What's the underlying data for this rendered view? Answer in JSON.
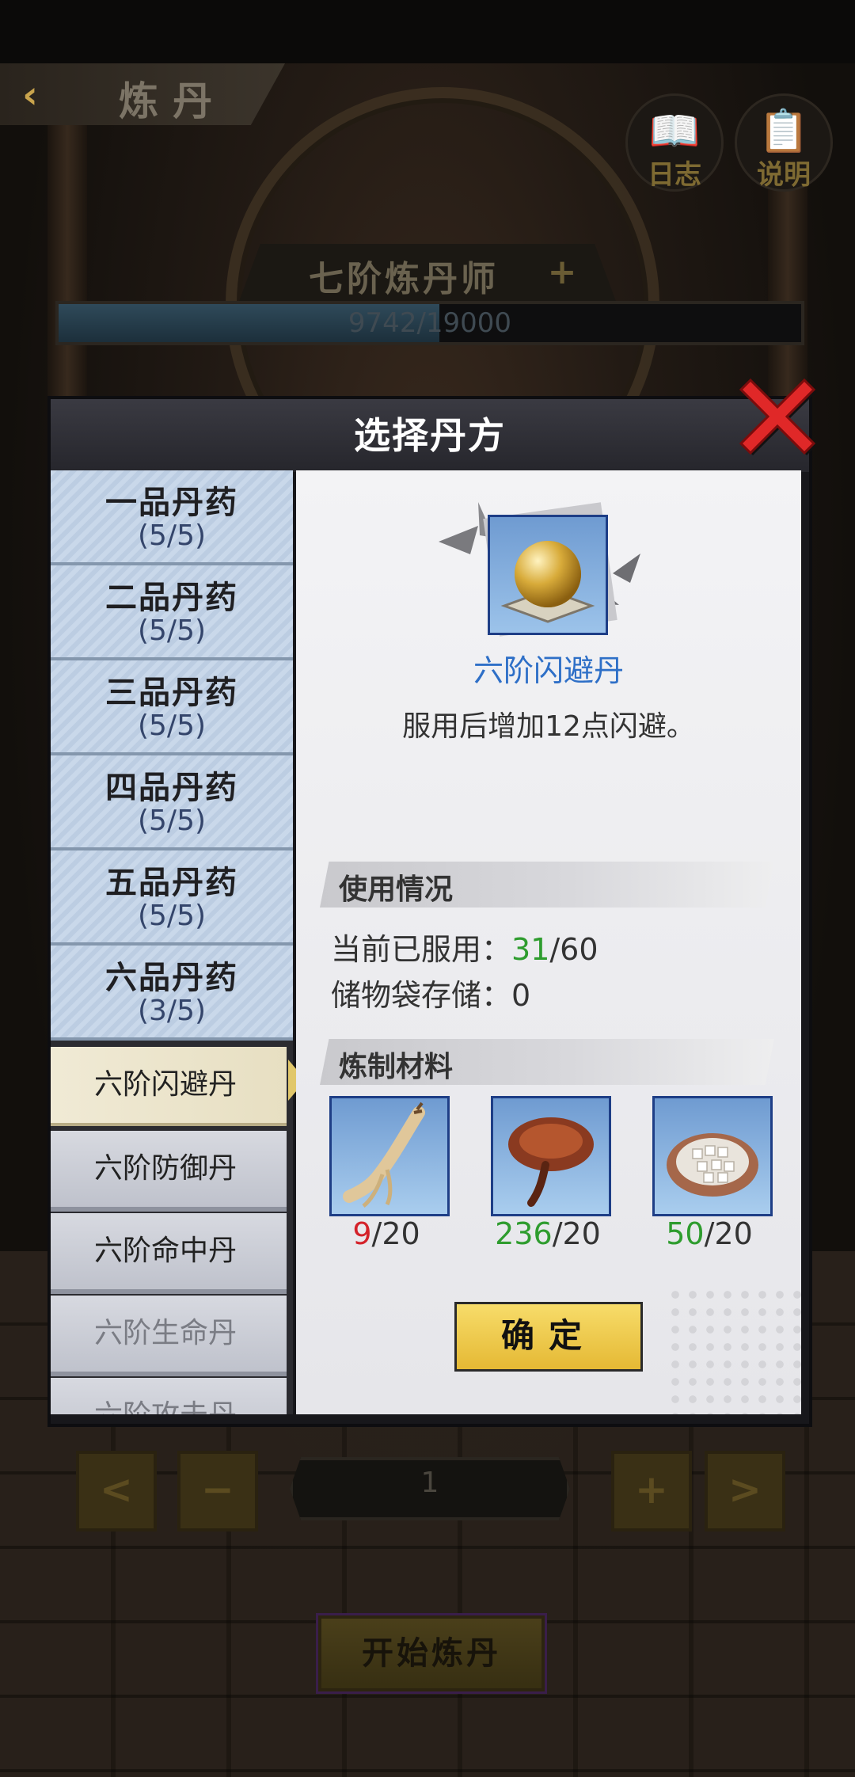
{
  "header": {
    "title": "炼丹"
  },
  "top_buttons": {
    "log_label": "日志",
    "help_label": "说明"
  },
  "rank": {
    "title": "七阶炼丹师",
    "progress_text": "9742/19000",
    "progress_value": 9742,
    "progress_max": 19000
  },
  "modal": {
    "title": "选择丹方"
  },
  "categories": [
    {
      "name": "一品丹药",
      "count": "(5/5)"
    },
    {
      "name": "二品丹药",
      "count": "(5/5)"
    },
    {
      "name": "三品丹药",
      "count": "(5/5)"
    },
    {
      "name": "四品丹药",
      "count": "(5/5)"
    },
    {
      "name": "五品丹药",
      "count": "(5/5)"
    },
    {
      "name": "六品丹药",
      "count": "(3/5)"
    }
  ],
  "pills": [
    {
      "label": "六阶闪避丹",
      "active": true
    },
    {
      "label": "六阶防御丹"
    },
    {
      "label": "六阶命中丹"
    },
    {
      "label": "六阶生命丹",
      "dim": true
    },
    {
      "label": "六阶攻击丹",
      "dim": true
    }
  ],
  "selected": {
    "name": "六阶闪避丹",
    "desc": "服用后增加12点闪避。",
    "icon": "golden-pill-icon"
  },
  "usage": {
    "title": "使用情况",
    "consumed_label": "当前已服用：",
    "consumed": "31",
    "consumed_max": "/60",
    "storage_label": "储物袋存储：",
    "storage": "0"
  },
  "materials": {
    "title": "炼制材料",
    "items": [
      {
        "icon": "ginseng-icon",
        "have": "9",
        "need": "/20",
        "sufficient": false
      },
      {
        "icon": "lingzhi-icon",
        "have": "236",
        "need": "/20",
        "sufficient": true
      },
      {
        "icon": "rice-bowl-icon",
        "have": "50",
        "need": "/20",
        "sufficient": true
      }
    ]
  },
  "confirm_label": "确定",
  "quantity": {
    "value": "1"
  },
  "controls": {
    "prev": "<",
    "minus": "−",
    "plus": "+",
    "next": ">"
  },
  "start_label": "开始炼丹",
  "colors": {
    "accent_gold": "#e5b934",
    "highlight_blue": "#2e6fc7",
    "ok_green": "#2e9c2e",
    "warn_red": "#d4222a"
  }
}
